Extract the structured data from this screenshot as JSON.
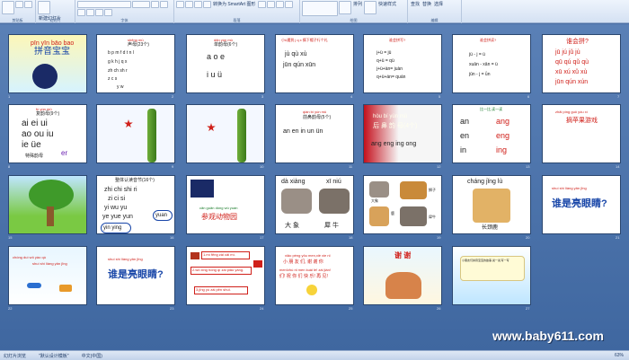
{
  "ribbon": {
    "groups": [
      {
        "label": "剪贴板"
      },
      {
        "label": "幻灯片"
      },
      {
        "label": "字体"
      },
      {
        "label": "段落"
      },
      {
        "label": "绘图"
      },
      {
        "label": "编辑"
      }
    ],
    "new_slide": "新建幻灯片",
    "convert_smartart": "转换为 SmartArt 图形",
    "arrange": "排列",
    "quick_styles": "快速样式",
    "find": "查找",
    "replace": "替换",
    "select": "选择"
  },
  "slides": [
    {
      "num": "1",
      "texts": [
        "pīn yīn bāo bao",
        "拼音宝宝"
      ]
    },
    {
      "num": "2",
      "texts": [
        "shēng mǔ",
        "声母(23个)",
        "b p m f d t n l",
        "g k h j q x",
        "zh ch sh r",
        "z c s",
        "y w"
      ]
    },
    {
      "num": "3",
      "texts": [
        "dān yùn mǔ",
        "单韵母(6个)",
        "a o e",
        "i u ü"
      ]
    },
    {
      "num": "4",
      "texts": [
        "小ü遇到 j q x 摘下帽子行个礼",
        "jù qù xù",
        "jūn qún xūn"
      ]
    },
    {
      "num": "5",
      "texts": [
        "谁会拼写?",
        "j+ü = jü",
        "q+ü = qü",
        "j+ü+àn= juàn",
        "q+ü+án= quán"
      ]
    },
    {
      "num": "6",
      "texts": [
        "谁会拼读?",
        "jü - j = ü",
        "xuān - xān = ü",
        "jūn - j = ǖn"
      ]
    },
    {
      "num": "7",
      "texts": [
        "谁会拼?",
        "jū jú jǔ jù",
        "qū qú qǔ qù",
        "xū xú xǔ xù",
        "jūn qún xún"
      ]
    },
    {
      "num": "8",
      "texts": [
        "fù yùn mǔ",
        "复韵母(9个)",
        "ai ei ui",
        "ao ou iu",
        "ie üe",
        "er",
        "特殊韵母"
      ]
    },
    {
      "num": "9",
      "texts": []
    },
    {
      "num": "10",
      "texts": []
    },
    {
      "num": "11",
      "texts": [
        "qián bí yùn mǔ",
        "前鼻韵母(5个)",
        "an en in un ün"
      ]
    },
    {
      "num": "12",
      "texts": [
        "hòu bí yùn mǔ",
        "后 鼻 韵 母(4个)",
        "ang eng ing ong"
      ]
    },
    {
      "num": "13",
      "texts": [
        "比一比,读一读",
        "an",
        "ang",
        "en",
        "eng",
        "in",
        "ing"
      ]
    },
    {
      "num": "14",
      "texts": [
        "zhāi píng guǒ yóu xì",
        "摘苹果游戏"
      ]
    },
    {
      "num": "15",
      "texts": []
    },
    {
      "num": "16",
      "texts": [
        "整体认读音节(16个)",
        "zhi chi shi ri",
        "zi ci si",
        "yi wu yu",
        "ye yue yun",
        "yuan",
        "yin ying"
      ]
    },
    {
      "num": "17",
      "texts": [
        "cān guān dòng wù yuán",
        "参观动物园"
      ]
    },
    {
      "num": "18",
      "texts": [
        "dà xiàng",
        "xī niú",
        "大 象",
        "犀 牛"
      ]
    },
    {
      "num": "19",
      "texts": [
        "大象",
        "鹿",
        "犀牛",
        "狮子"
      ]
    },
    {
      "num": "20",
      "texts": [
        "cháng jǐng lù",
        "长颈鹿"
      ]
    },
    {
      "num": "21",
      "texts": [
        "shuí shì liàng yǎn jīng",
        "谁是亮眼睛?"
      ]
    },
    {
      "num": "22",
      "texts": [
        "chóng duì wǒ yào qù",
        "shuí shì liàng yǎn jīng"
      ]
    },
    {
      "num": "23",
      "texts": [
        "shuí shì liàng yǎn jīng",
        "谁是亮眼睛?"
      ]
    },
    {
      "num": "24",
      "texts": [
        "1.mì fēng zài cǎi mì.",
        "2.wǒ xǐng hóng qí zài piāo yáng.",
        "3.jīng yú zài pēn shuǐ."
      ]
    },
    {
      "num": "25",
      "texts": [
        "xiǎo péng yǒu men,xiè xie nǐ",
        "小 朋 友 们, 谢 谢 你",
        "men!zhù nǐ men kuài lè! zài jiàn!",
        "们! 祝 你 们 快 乐! 再 见!"
      ]
    },
    {
      "num": "26",
      "texts": [
        "谢 谢"
      ]
    },
    {
      "num": "27",
      "texts": [
        "小朋友们拼音宝宝的故事,说一说,写一写"
      ]
    }
  ],
  "status": {
    "left": "幻灯片浏览",
    "theme": "\"默认设计模板\"",
    "lang": "中文(中国)",
    "zoom": "63%"
  },
  "watermark": "www.baby611.com"
}
